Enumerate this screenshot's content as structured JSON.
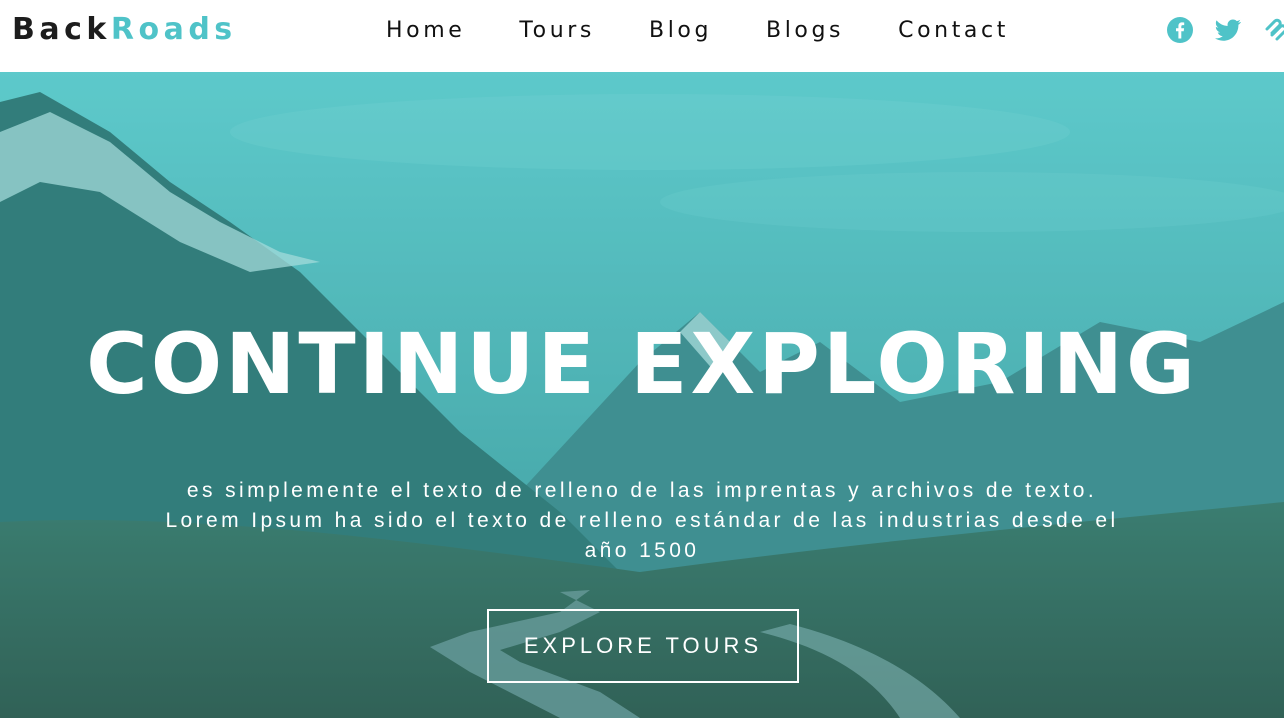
{
  "brand": {
    "part1": "Back",
    "part2": "Roads"
  },
  "nav": {
    "links": [
      "Home",
      "Tours",
      "Blog",
      "Blogs",
      "Contact"
    ]
  },
  "social": {
    "icons": [
      "facebook-icon",
      "twitter-icon",
      "squarespace-icon"
    ]
  },
  "hero": {
    "title": "CONTINUE EXPLORING",
    "text": "es simplemente el texto de relleno de las imprentas y archivos de texto. Lorem Ipsum ha sido el texto de relleno estándar de las industrias desde el año 1500",
    "button_label": "EXPLORE TOURS"
  },
  "colors": {
    "accent": "#4fc3c8",
    "text_dark": "#111111",
    "navbar_bg": "#ffffff",
    "hero_overlay": "#3fb5b8"
  }
}
